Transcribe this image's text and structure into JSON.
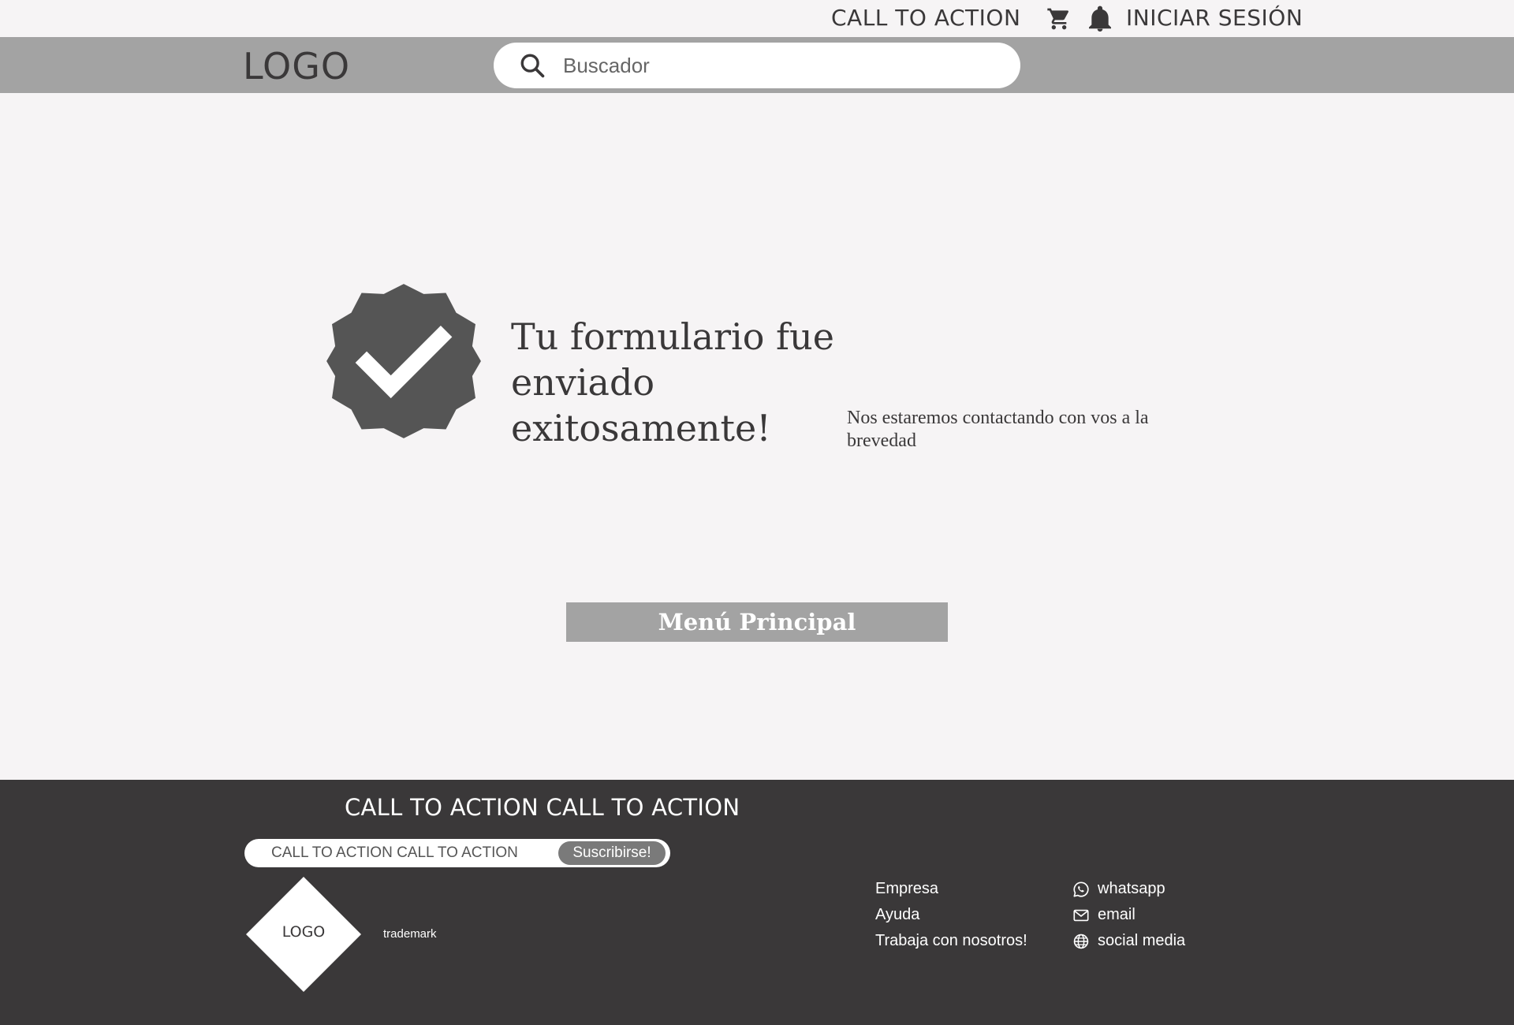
{
  "topbar": {
    "cta_label": "CALL TO ACTION",
    "login_label": "INICIAR SESIÓN",
    "icons": [
      "cart-icon",
      "bell-icon"
    ]
  },
  "header": {
    "logo_text": "LOGO",
    "search": {
      "placeholder": "Buscador",
      "value": ""
    }
  },
  "main": {
    "title": "Tu formulario fue enviado exitosamente!",
    "subtitle": "Nos estaremos contactando con vos a la brevedad",
    "button_label": "Menú Principal"
  },
  "footer": {
    "cta_heading": "CALL TO ACTION CALL TO ACTION",
    "subscribe": {
      "placeholder": "CALL TO ACTION CALL TO ACTION",
      "button_label": "Suscribirse!"
    },
    "logo_text": "LOGO",
    "trademark": "trademark",
    "links": [
      "Empresa",
      "Ayuda",
      "Trabaja con nosotros!"
    ],
    "contacts": [
      {
        "icon": "whatsapp-icon",
        "label": "whatsapp"
      },
      {
        "icon": "email-icon",
        "label": "email"
      },
      {
        "icon": "globe-icon",
        "label": "social media"
      }
    ]
  },
  "colors": {
    "background": "#f6f4f5",
    "header_band": "#a3a3a3",
    "footer": "#3a3839",
    "text_dark": "#3a3839",
    "badge": "#555555",
    "button": "#a3a3a3"
  }
}
